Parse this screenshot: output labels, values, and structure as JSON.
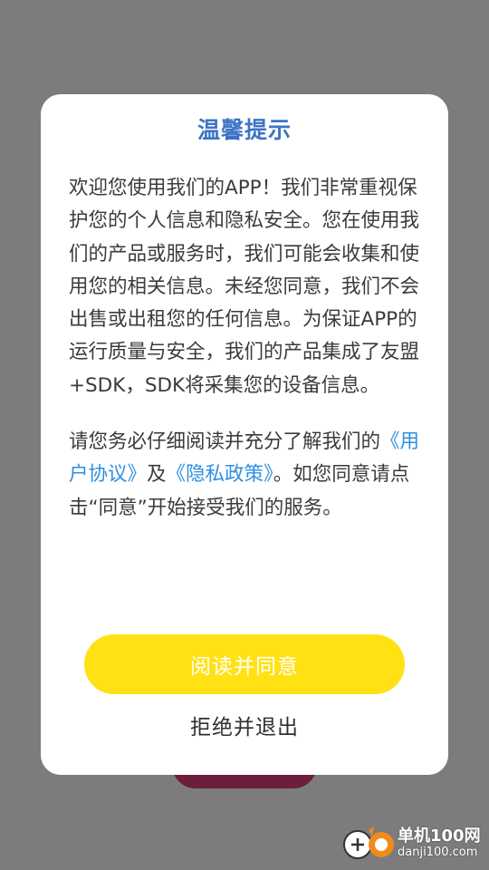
{
  "dialog": {
    "title": "温馨提示",
    "paragraph1": "欢迎您使用我们的APP！我们非常重视保护您的个人信息和隐私安全。您在使用我们的产品或服务时，我们可能会收集和使用您的相关信息。未经您同意，我们不会出售或出租您的任何信息。为保证APP的运行质量与安全，我们的产品集成了友盟+SDK，SDK将采集您的设备信息。",
    "paragraph2_prefix": "请您务必仔细阅读并充分了解我们的",
    "user_agreement_link": "《用户协议》",
    "and_text": "及",
    "privacy_policy_link": "《隐私政策》",
    "paragraph2_suffix": "。如您同意请点击“同意”开始接受我们的服务。",
    "agree_button": "阅读并同意",
    "refuse_button": "拒绝并退出"
  },
  "watermark": {
    "brand": "单机100网",
    "domain": "danji100.com"
  },
  "colors": {
    "title": "#3d74c4",
    "link": "#2e8fe0",
    "agree_button_bg": "#ffe114",
    "overlay": "#7c7c7c"
  }
}
